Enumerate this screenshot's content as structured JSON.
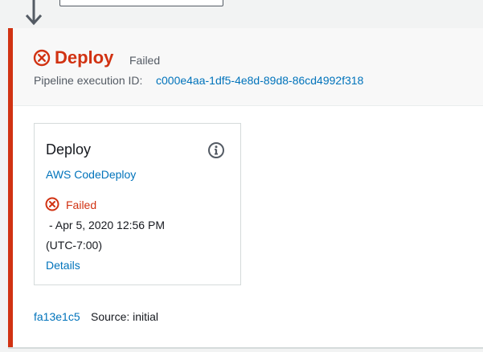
{
  "stage": {
    "name": "Deploy",
    "status": "Failed",
    "execution_label": "Pipeline execution ID:",
    "execution_id": "c000e4aa-1df5-4e8d-89d8-86cd4992f318",
    "status_color": "#d13212"
  },
  "action": {
    "name": "Deploy",
    "provider": "AWS CodeDeploy",
    "status": "Failed",
    "time_line1": "-  Apr 5, 2020 12:56 PM",
    "time_line2": "(UTC-7:00)",
    "details_label": "Details",
    "info_icon": "info-icon"
  },
  "source": {
    "commit_id": "fa13e1c5",
    "message": "Source: initial"
  },
  "colors": {
    "link": "#0073bb",
    "error": "#d13212",
    "text": "#16191f",
    "muted": "#545b64"
  }
}
